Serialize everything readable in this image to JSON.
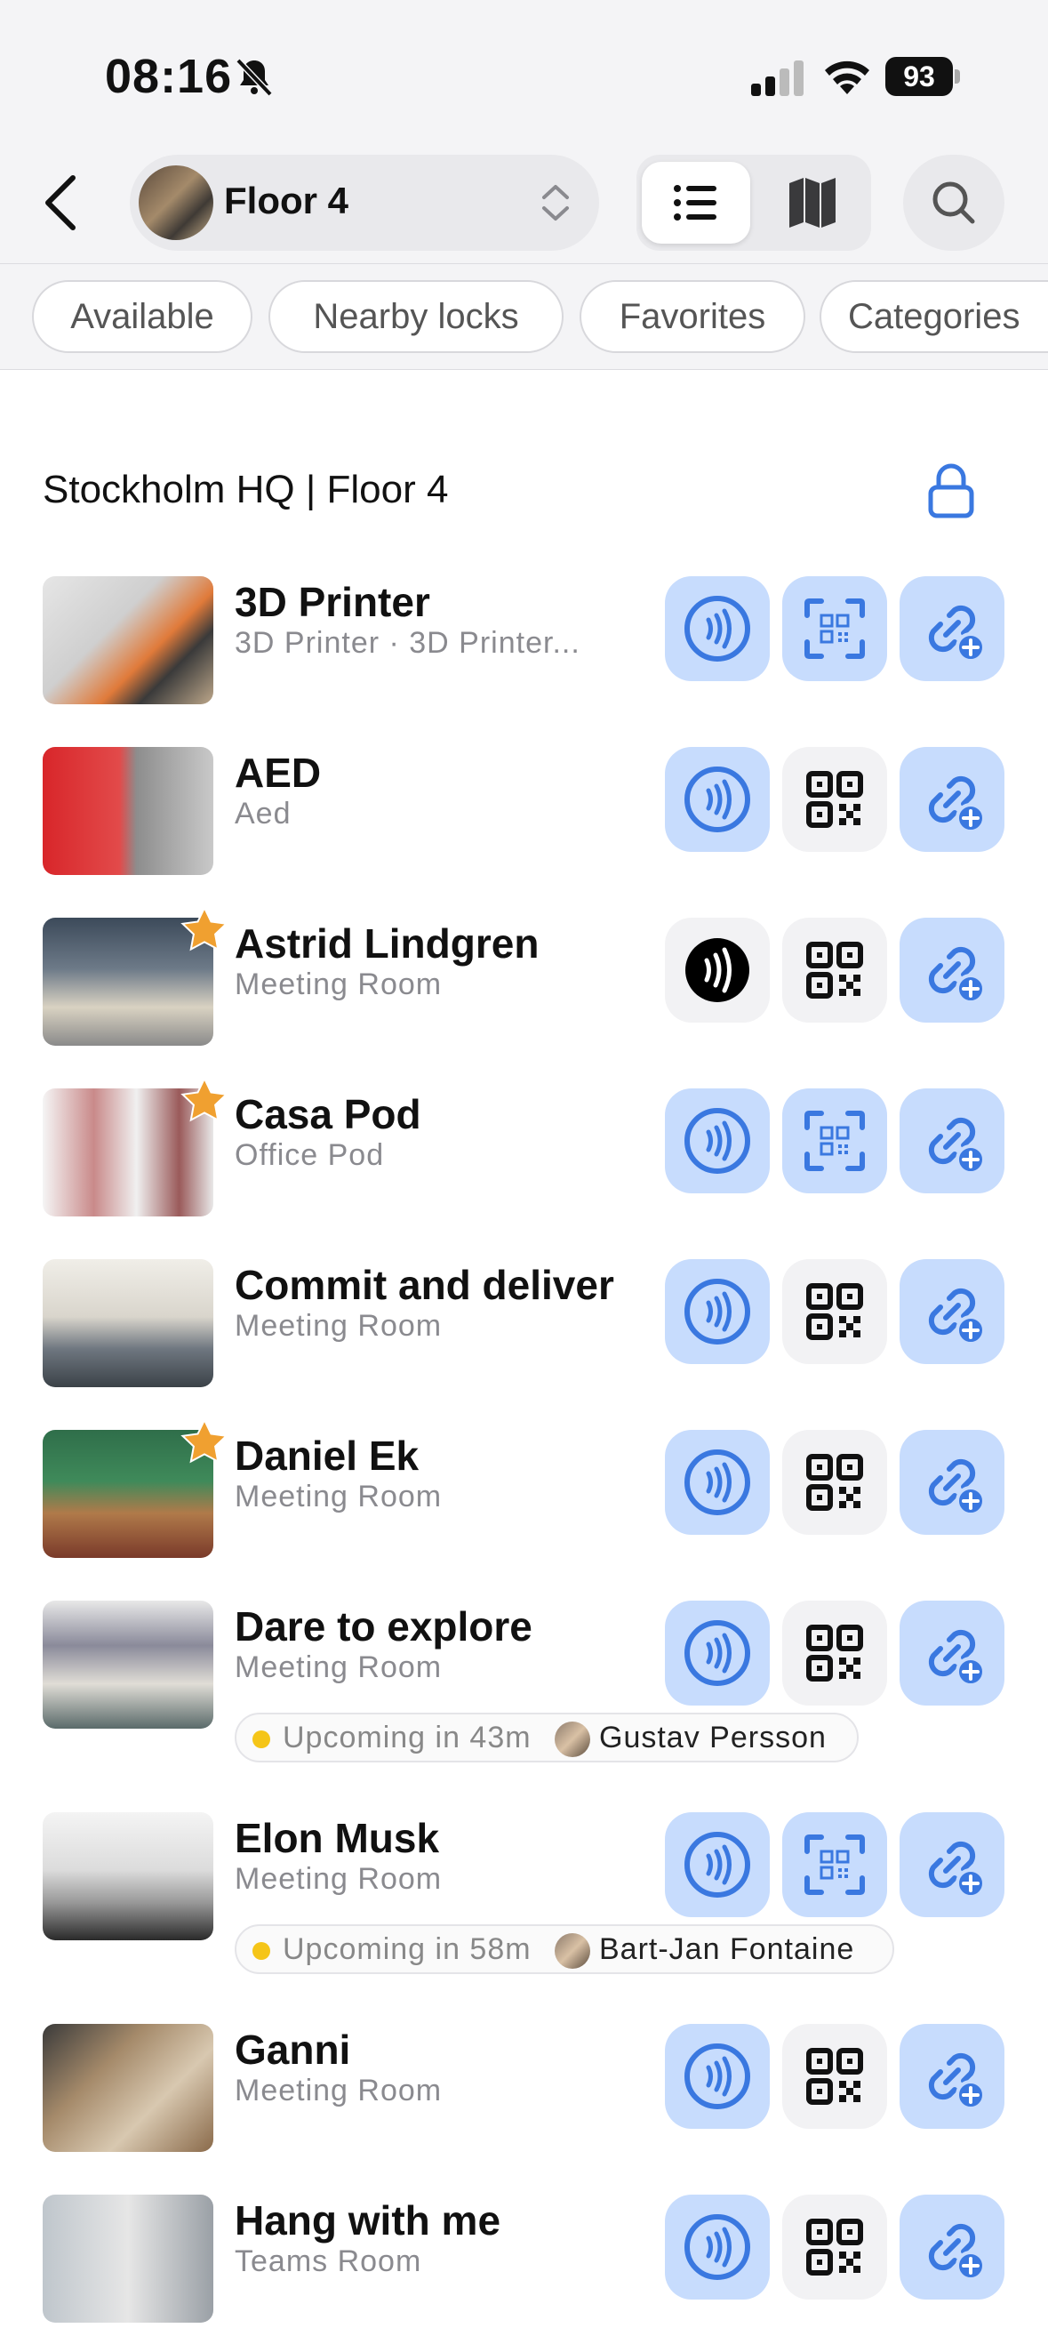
{
  "status_bar": {
    "time": "08:16",
    "battery": "93"
  },
  "header": {
    "floor_selector": "Floor 4",
    "view_modes": [
      "list-icon",
      "map-icon"
    ],
    "search": "search-icon"
  },
  "filters": [
    "Available",
    "Nearby locks",
    "Favorites",
    "Categories"
  ],
  "section": {
    "title": "Stockholm HQ | Floor 4"
  },
  "items": [
    {
      "name": "3D Printer",
      "subtitle": "3D Printer · 3D Printer...",
      "favorite": false,
      "nfc": "blue",
      "qr": "blue"
    },
    {
      "name": "AED",
      "subtitle": "Aed",
      "favorite": false,
      "nfc": "blue",
      "qr": "grey"
    },
    {
      "name": "Astrid Lindgren",
      "subtitle": "Meeting Room",
      "favorite": true,
      "nfc": "black",
      "qr": "grey"
    },
    {
      "name": "Casa Pod",
      "subtitle": "Office Pod",
      "favorite": true,
      "nfc": "blue",
      "qr": "blue"
    },
    {
      "name": "Commit and deliver",
      "subtitle": "Meeting Room",
      "favorite": false,
      "nfc": "blue",
      "qr": "grey"
    },
    {
      "name": "Daniel Ek",
      "subtitle": "Meeting Room",
      "favorite": true,
      "nfc": "blue",
      "qr": "grey"
    },
    {
      "name": "Dare to explore",
      "subtitle": "Meeting Room",
      "favorite": false,
      "nfc": "blue",
      "qr": "grey",
      "upcoming": {
        "text": "Upcoming in 43m",
        "person": "Gustav Persson"
      }
    },
    {
      "name": "Elon Musk",
      "subtitle": "Meeting Room",
      "favorite": false,
      "nfc": "blue",
      "qr": "blue",
      "upcoming": {
        "text": "Upcoming in 58m",
        "person": "Bart-Jan Fontaine"
      }
    },
    {
      "name": "Ganni",
      "subtitle": "Meeting Room",
      "favorite": false,
      "nfc": "blue",
      "qr": "grey"
    },
    {
      "name": "Hang with me",
      "subtitle": "Teams Room",
      "favorite": false,
      "nfc": "blue",
      "qr": "grey"
    }
  ],
  "colors": {
    "accent": "#3a78e0",
    "button_blue_bg": "#c7dcfd",
    "star": "#f0a030",
    "upcoming_dot": "#f5c518"
  }
}
